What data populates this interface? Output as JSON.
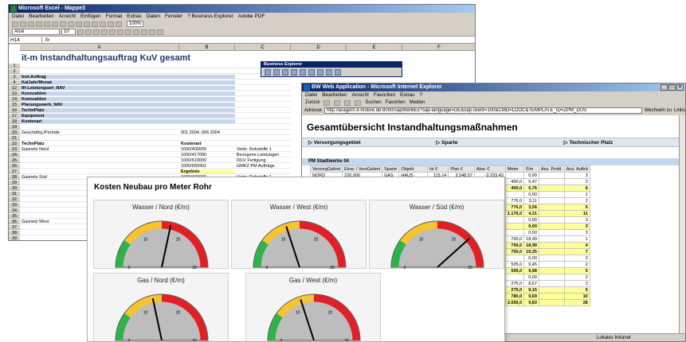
{
  "excel": {
    "title": "Microsoft Excel - Mappe3",
    "menu": [
      "Datei",
      "Bearbeiten",
      "Ansicht",
      "Einfügen",
      "Format",
      "Extras",
      "Daten",
      "Fenster",
      "? Business Explorer",
      "Adobe PDF"
    ],
    "font": "Arial",
    "size": "10",
    "zoom": "100%",
    "cell_ref": "H14",
    "cols": [
      "A",
      "B",
      "C",
      "D",
      "E",
      "F"
    ],
    "title_row": "it-m Instandhaltungsauftrag KuV gesamt",
    "rows": [
      {
        "n": "1",
        "a": "",
        "b": "",
        "c": ""
      },
      {
        "n": "2",
        "a": "",
        "b": "",
        "c": ""
      },
      {
        "n": "3",
        "a": "Inst.Auftrag",
        "b": "",
        "c": ""
      },
      {
        "n": "4",
        "a": "KalJahr/Monat",
        "b": "",
        "c": ""
      },
      {
        "n": "12",
        "a": "IH-Leistungsart_NAV",
        "b": "",
        "c": ""
      },
      {
        "n": "13",
        "a": "Kennzahlen",
        "b": "",
        "c": ""
      },
      {
        "n": "14",
        "a": "Kennzahlen",
        "b": "",
        "c": ""
      },
      {
        "n": "15",
        "a": "Planungswerk_NAV",
        "b": "",
        "c": ""
      },
      {
        "n": "16",
        "a": "TechnPlatz",
        "b": "",
        "c": ""
      },
      {
        "n": "17",
        "a": "Equipment",
        "b": "",
        "c": ""
      },
      {
        "n": "18",
        "a": "Kostenart",
        "b": "",
        "c": ""
      },
      {
        "n": "19",
        "a": "",
        "b": "",
        "c": ""
      },
      {
        "n": "20",
        "a": "Geschäftsj./Periode",
        "b": "001.2004..006.2004",
        "c": ""
      },
      {
        "n": "21",
        "a": "",
        "b": "",
        "c": ""
      },
      {
        "n": "22",
        "a": "TechnPlatz",
        "b": "Kostenart",
        "c": ""
      },
      {
        "n": "23",
        "a": "Gasnetz Nord",
        "b": "1000/400000",
        "c": "Verbr. Rohstoffe 1"
      },
      {
        "n": "24",
        "a": "",
        "b": "1000/417000",
        "c": "Bezogene Leistungen"
      },
      {
        "n": "25",
        "a": "",
        "b": "1000/619000",
        "c": "DILV Fertigung"
      },
      {
        "n": "26",
        "a": "",
        "b": "1000/655901",
        "c": "GMKZ PM Aufträge"
      },
      {
        "n": "27",
        "a": "",
        "b": "Ergebnis",
        "c": ""
      },
      {
        "n": "28",
        "a": "Gasnetz Süd",
        "b": "1000/400000",
        "c": "Verbr. Rohstoffe 1"
      },
      {
        "n": "29",
        "a": "",
        "b": "1000/415000",
        "c": "Kosten Fremdbezug"
      },
      {
        "n": "30",
        "a": "",
        "b": "",
        "c": ""
      },
      {
        "n": "31",
        "a": "",
        "b": "",
        "c": ""
      },
      {
        "n": "32",
        "a": "",
        "b": "",
        "c": ""
      },
      {
        "n": "33",
        "a": "",
        "b": "",
        "c": ""
      },
      {
        "n": "34",
        "a": "",
        "b": "",
        "c": ""
      },
      {
        "n": "35",
        "a": "",
        "b": "",
        "c": ""
      },
      {
        "n": "36",
        "a": "Gasnetz West",
        "b": "",
        "c": ""
      },
      {
        "n": "37",
        "a": "",
        "b": "",
        "c": ""
      },
      {
        "n": "38",
        "a": "",
        "b": "",
        "c": ""
      },
      {
        "n": "39",
        "a": "",
        "b": "",
        "c": ""
      },
      {
        "n": "40",
        "a": "",
        "b": "",
        "c": ""
      }
    ]
  },
  "bex": {
    "title": "Business Explorer"
  },
  "ie": {
    "title": "BW Web Application - Microsoft Internet Explorer",
    "menu": [
      "Datei",
      "Bearbeiten",
      "Ansicht",
      "Favoriten",
      "Extras",
      "?"
    ],
    "back": "Zurück",
    "search": "Suchen",
    "favorites": "Favoriten",
    "media": "Medien",
    "address_label": "Adresse",
    "url": "http://aragorn.it-motive.de:8000/sap/bw/BEx?sap-language=DE&sap-client=100&CMD=LDOC&TEMPLATE_ID=ZPM_DUS",
    "go": "Wechseln zu",
    "links": "Links",
    "page_title": "Gesamtübersicht Instandhaltungsmaßnahmen",
    "sections": [
      "Versorgungsgebiet",
      "Sparte",
      "Technischer Platz"
    ],
    "group": "PM Stadtwerke 04",
    "headers": [
      "VersorgGebiet",
      "Einw. / VersGebiet",
      "Sparte",
      "Objekt",
      "Ist €",
      "Plan €",
      "Abw. €",
      "Meter",
      "€/m",
      "Anz. Probl.",
      "Anz. Aufträ"
    ],
    "rows": [
      [
        "NORD",
        "220.000",
        "GAS",
        "HAUS",
        "115,14",
        "3.348,57",
        "-3.233,43",
        "",
        "0,00",
        "",
        "3"
      ],
      [
        "",
        "",
        "",
        "ROHRNETZ",
        "2.182,06",
        "202.667,85",
        "-300.480,80",
        "400,0",
        "5,47",
        "",
        "3"
      ],
      [
        "",
        "",
        "",
        "",
        "",
        "206.016,42",
        "-303.714,23",
        "400,0",
        "5,76",
        "",
        "6"
      ],
      [
        "",
        "",
        "",
        "",
        "",
        "4.165,71",
        "-3.612,04",
        "",
        "0,00",
        "",
        "1"
      ],
      [
        "",
        "",
        "",
        "",
        "",
        "61.718,96",
        "-239.308,69",
        "776,0",
        "3,11",
        "",
        "2"
      ],
      [
        "",
        "",
        "",
        "",
        "",
        "385.084,67",
        "-243.120,63",
        "776,0",
        "3,56",
        "",
        "5"
      ],
      [
        "",
        "",
        "",
        "",
        "",
        "551.901,09",
        "-546.834,86",
        "1.176,0",
        "4,31",
        "",
        "11"
      ],
      [
        "",
        "",
        "",
        "",
        "",
        "5.608,09",
        "-5.427,15",
        "",
        "0,00",
        "",
        "3"
      ],
      [
        "",
        "",
        "",
        "",
        "",
        "5.608,09",
        "-5.427,15",
        "",
        "0,00",
        "",
        "3"
      ],
      [
        "",
        "",
        "",
        "",
        "",
        "3.865,71",
        "-3.512,05",
        "",
        "0,00",
        "",
        "3"
      ],
      [
        "",
        "",
        "",
        "",
        "",
        "12.941,49",
        "0,00",
        "700,0",
        "18,49",
        "",
        "1"
      ],
      [
        "",
        "",
        "",
        "",
        "",
        "16.807,20",
        "-3.512,05",
        "700,0",
        "18,99",
        "",
        "4"
      ],
      [
        "",
        "",
        "",
        "",
        "",
        "22.415,29",
        "-8.939,20",
        "700,0",
        "19,25",
        "",
        "7"
      ],
      [
        "",
        "",
        "",
        "",
        "",
        "3.889,52",
        "-3.618,11",
        "",
        "0,00",
        "",
        "3"
      ],
      [
        "",
        "",
        "",
        "",
        "",
        "20.066,41",
        "-615.296,08",
        "505,0",
        "9,45",
        "",
        "2"
      ],
      [
        "",
        "",
        "",
        "",
        "",
        "23.955,93",
        "-618.914,19",
        "505,0",
        "9,98",
        "",
        "5"
      ],
      [
        "",
        "",
        "",
        "",
        "",
        "2.664,77",
        "-2.533,17",
        "",
        "0,00",
        "",
        "2"
      ],
      [
        "",
        "",
        "",
        "",
        "",
        "37.809,44",
        "-395.424,27",
        "275,0",
        "8,67",
        "",
        "3"
      ],
      [
        "",
        "",
        "",
        "",
        "",
        "40.474,21",
        "-397.957,44",
        "275,0",
        "9,15",
        "",
        "5"
      ],
      [
        "",
        "",
        "",
        "",
        "",
        "74.430,14",
        "-1.016.871,63",
        "780,0",
        "9,69",
        "",
        "10"
      ],
      [
        "",
        "",
        "",
        "",
        "",
        "90.746,52",
        "-1.572.645,69",
        "2.656,0",
        "9,83",
        "",
        "28"
      ]
    ],
    "yellow_rows": [
      2,
      5,
      6,
      8,
      11,
      12,
      15,
      18,
      19,
      20
    ],
    "status": "Lokales Intranet"
  },
  "dashboard": {
    "title": "Kosten Neubau pro Meter Rohr",
    "gauges": [
      {
        "title": "Wasser / Nord (€/m)",
        "value": 17
      },
      {
        "title": "Wasser / West (€/m)",
        "value": 12
      },
      {
        "title": "Wasser / Süd (€/m)",
        "value": 23
      },
      {
        "title": "Gas / Nord (€/m)",
        "value": 13
      },
      {
        "title": "Gas / West (€/m)",
        "value": 12
      }
    ],
    "scale": {
      "min": 0,
      "max": 30,
      "ticks": [
        "0",
        "10",
        "20",
        "30"
      ]
    },
    "colors": {
      "green": "#2db34a",
      "yellow": "#f6c431",
      "red": "#e31f26"
    }
  }
}
